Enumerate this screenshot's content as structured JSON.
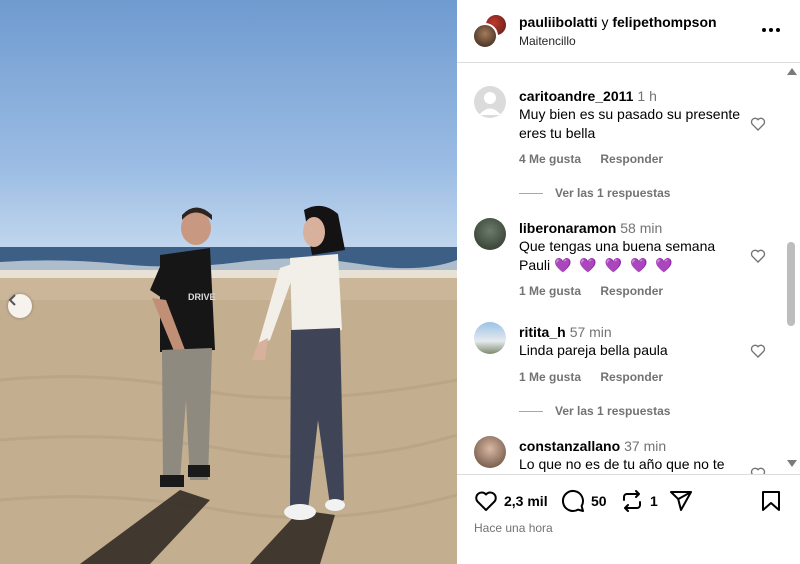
{
  "post": {
    "authors": {
      "user1": "pauliibolatti",
      "conjunction": "y",
      "user2": "felipethompson"
    },
    "location": "Maitencillo",
    "more_icon": "more-horizontal-icon"
  },
  "comments": [
    {
      "username": "caritoandre_2011",
      "time": "1 h",
      "text_line1": "Muy bien es su pasado su presente",
      "text_line2": "eres tu bella",
      "likes": "4 Me gusta",
      "reply": "Responder",
      "view_replies": "Ver las 1 respuestas"
    },
    {
      "username": "liberonaramon",
      "time": "58 min",
      "text_line1": "Que tengas una buena semana",
      "text_line2": "Pauli",
      "emojis": "💜 💜 💜 💜 💜",
      "likes": "1 Me gusta",
      "reply": "Responder"
    },
    {
      "username": "ritita_h",
      "time": "57 min",
      "text_line1": "Linda pareja bella paula",
      "likes": "1 Me gusta",
      "reply": "Responder",
      "view_replies": "Ver las 1 respuestas"
    },
    {
      "username": "constanzallano",
      "time": "37 min",
      "text_line1": "Lo que no es de tu año que no te"
    }
  ],
  "actions": {
    "likes": "2,3 mil",
    "comments": "50",
    "reposts": "1"
  },
  "timeago": "Hace una hora"
}
